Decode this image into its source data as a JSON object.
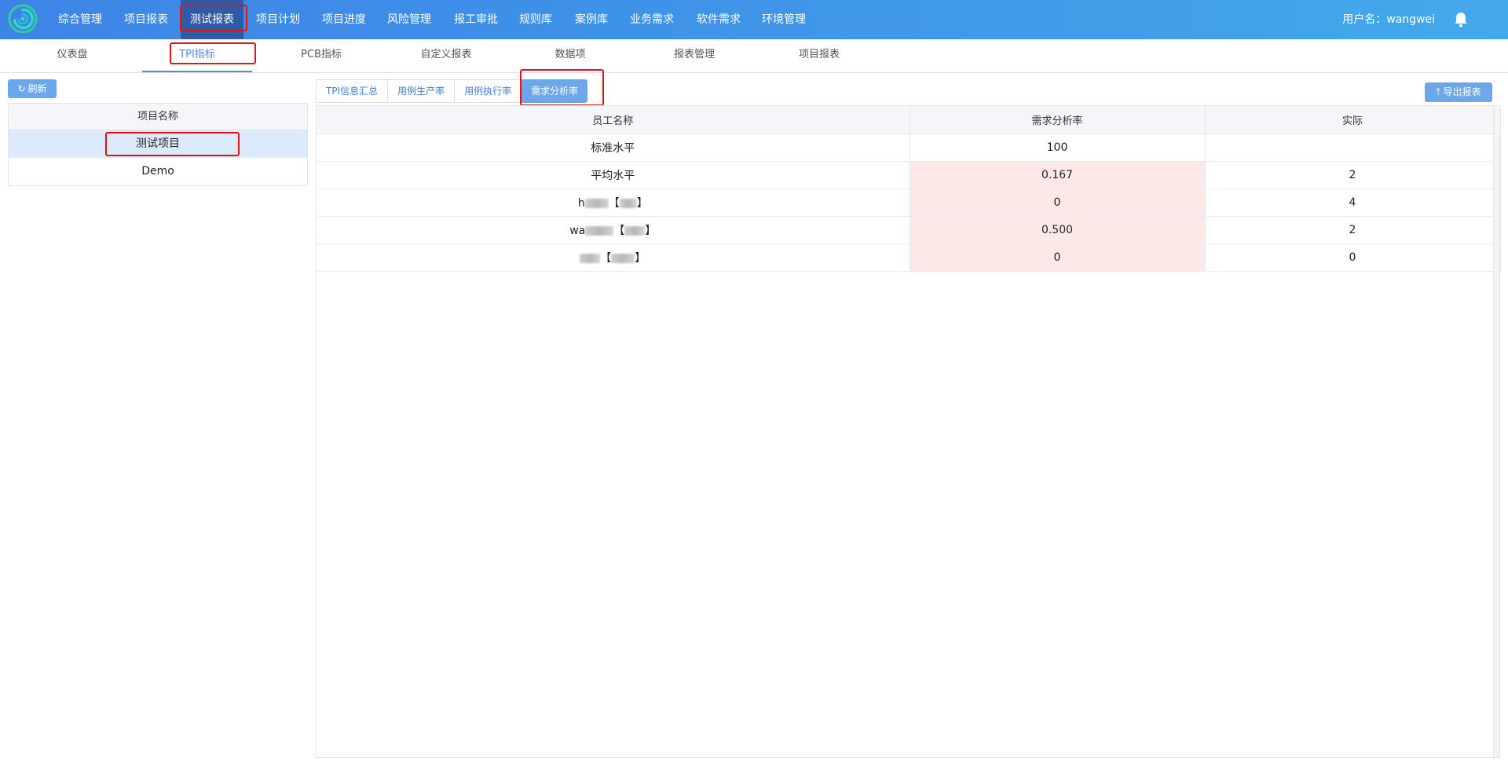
{
  "nav": {
    "items": [
      {
        "label": "综合管理"
      },
      {
        "label": "项目报表"
      },
      {
        "label": "测试报表"
      },
      {
        "label": "项目计划"
      },
      {
        "label": "项目进度"
      },
      {
        "label": "风险管理"
      },
      {
        "label": "报工审批"
      },
      {
        "label": "规则库"
      },
      {
        "label": "案例库"
      },
      {
        "label": "业务需求"
      },
      {
        "label": "软件需求"
      },
      {
        "label": "环境管理"
      }
    ],
    "active": "测试报表",
    "user_label": "用户名：wangwei"
  },
  "subnav": {
    "items": [
      {
        "label": "仪表盘"
      },
      {
        "label": "TPI指标"
      },
      {
        "label": "PCB指标"
      },
      {
        "label": "自定义报表"
      },
      {
        "label": "数据项"
      },
      {
        "label": "报表管理"
      },
      {
        "label": "项目报表"
      }
    ],
    "active": "TPI指标"
  },
  "left": {
    "refresh_label": "刷新",
    "header": "项目名称",
    "rows": [
      {
        "name": "测试项目",
        "selected": true
      },
      {
        "name": "Demo",
        "selected": false
      }
    ]
  },
  "tabs": {
    "items": [
      {
        "label": "TPI信息汇总"
      },
      {
        "label": "用例生产率"
      },
      {
        "label": "用例执行率"
      },
      {
        "label": "需求分析率"
      }
    ],
    "active": "需求分析率",
    "export_label": "导出报表"
  },
  "table": {
    "columns": [
      "员工名称",
      "需求分析率",
      "实际"
    ],
    "rows": [
      {
        "name": "标准水平",
        "rate": "100",
        "actual": "",
        "warn": false
      },
      {
        "name": "平均水平",
        "rate": "0.167",
        "actual": "2",
        "warn": true
      },
      {
        "name_prefix": "h",
        "name_suffix": "【",
        "name_end": "】",
        "rate": "0",
        "actual": "4",
        "warn": true
      },
      {
        "name_prefix": "wa",
        "name_suffix": "【",
        "name_end": "】",
        "rate": "0.500",
        "actual": "2",
        "warn": true
      },
      {
        "name_prefix": "",
        "name_suffix": "【",
        "name_end": "】",
        "rate": "0",
        "actual": "0",
        "warn": true
      }
    ]
  },
  "colors": {
    "nav_gradient_start": "#3d84e6",
    "nav_gradient_end": "#44a9ea",
    "accent": "#6da7ea",
    "highlight_box": "#e11414",
    "warn_cell": "#fde8e8",
    "selected_row": "#dcebfb"
  }
}
